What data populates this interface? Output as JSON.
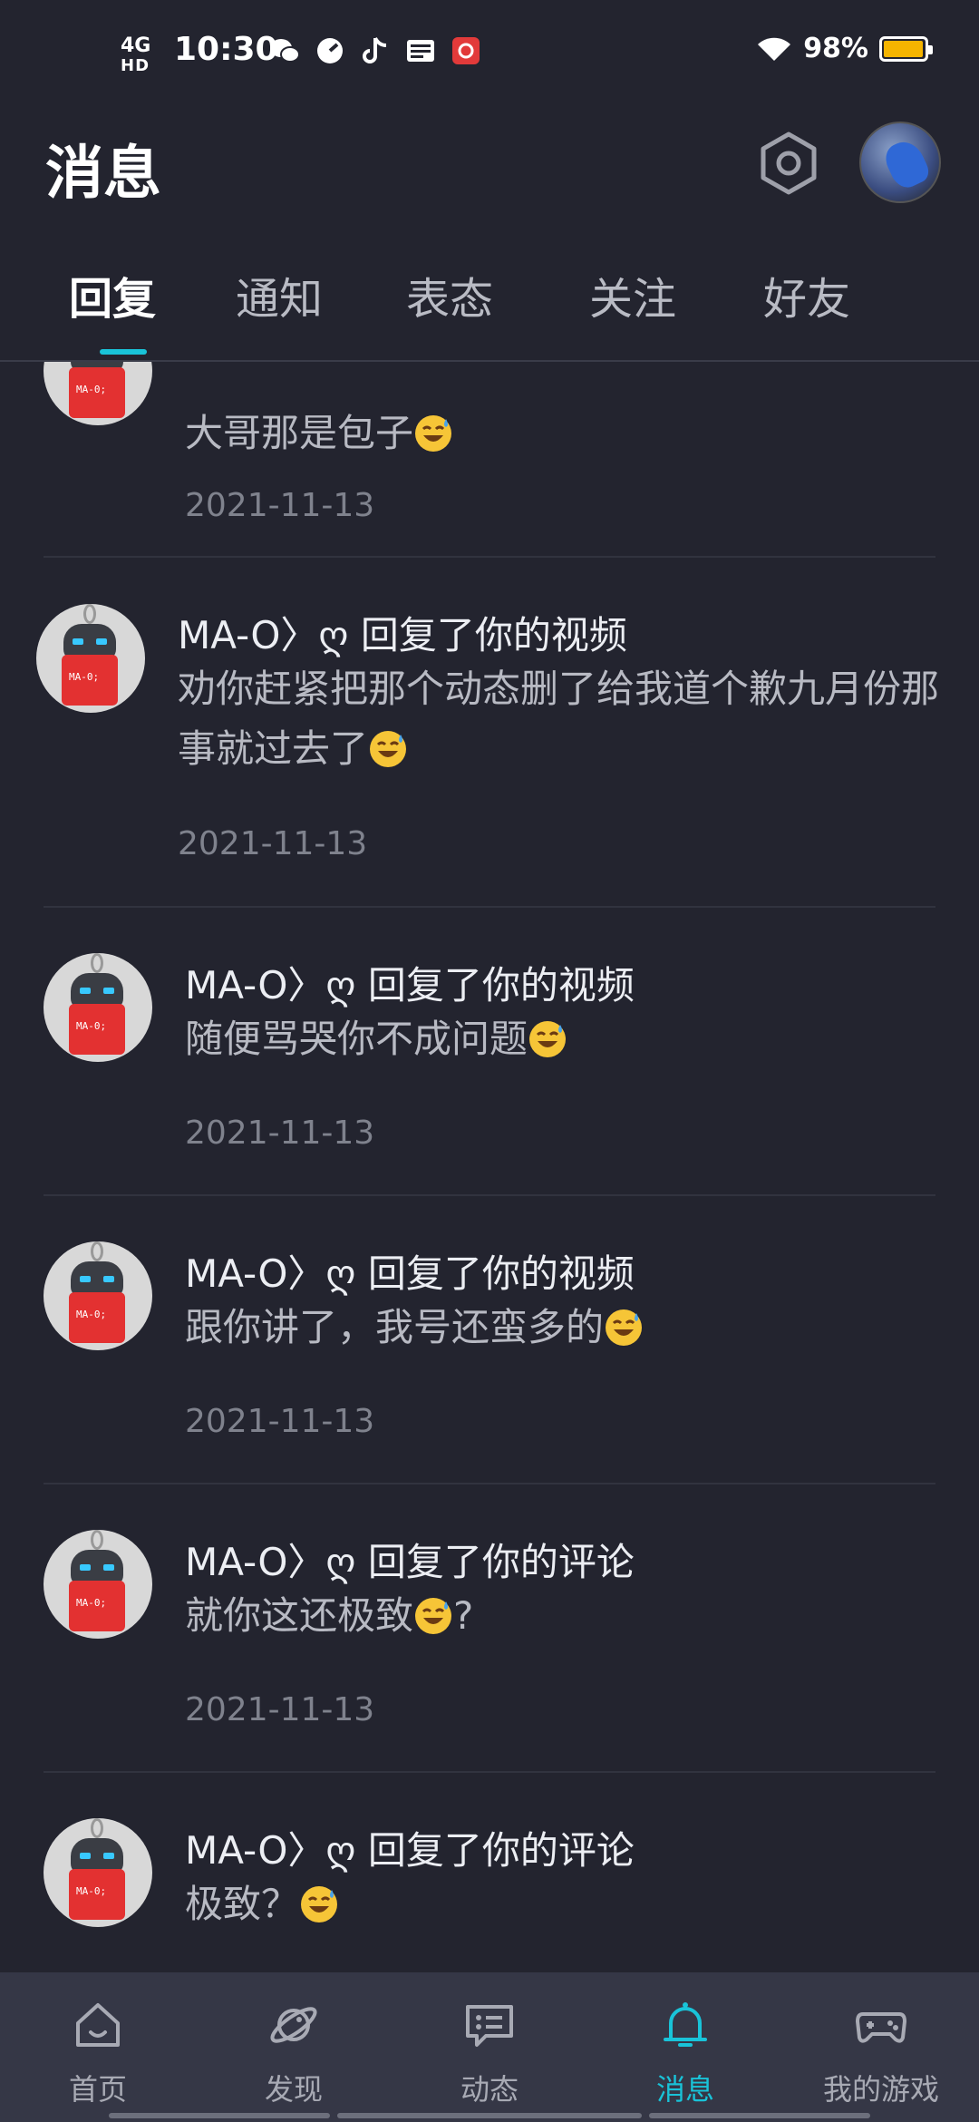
{
  "status_bar": {
    "network": "4G",
    "network_sub": "HD",
    "time": "10:30",
    "battery_text": "98%",
    "battery_level": 0.98,
    "battery_color": "#f5b400",
    "app_icons": [
      "wechat-icon",
      "speed-icon",
      "tiktok-icon",
      "toutiao-icon",
      "app-gift-icon"
    ]
  },
  "header": {
    "title": "消息",
    "settings_icon": "hexagon-settings-icon",
    "avatar_icon": "user-avatar"
  },
  "tabs": [
    {
      "label": "回复",
      "active": true
    },
    {
      "label": "通知",
      "active": false
    },
    {
      "label": "表态",
      "active": false
    },
    {
      "label": "关注",
      "active": false
    },
    {
      "label": "好友",
      "active": false
    }
  ],
  "accent_color": "#19c3d8",
  "messages": [
    {
      "user": "",
      "action": "",
      "text": "大哥那是包子",
      "emoji": "sweat-smile",
      "date": "2021-11-13"
    },
    {
      "user": "MA-O〉ღ",
      "action": "回复了你的视频",
      "text": "劝你赶紧把那个动态删了给我道个歉九月份那事就过去了",
      "emoji": "sweat-smile",
      "date": "2021-11-13"
    },
    {
      "user": "MA-O〉ღ",
      "action": "回复了你的视频",
      "text": "随便骂哭你不成问题",
      "emoji": "sweat-smile",
      "date": "2021-11-13"
    },
    {
      "user": "MA-O〉ღ",
      "action": "回复了你的视频",
      "text": "跟你讲了，我号还蛮多的",
      "emoji": "sweat-smile",
      "date": "2021-11-13"
    },
    {
      "user": "MA-O〉ღ",
      "action": "回复了你的评论",
      "text": "就你这还极致",
      "emoji": "sweat-smile",
      "suffix": "?",
      "date": "2021-11-13"
    },
    {
      "user": "MA-O〉ღ",
      "action": "回复了你的评论",
      "text": "极致？",
      "emoji": "sweat-smile",
      "date": ""
    }
  ],
  "bottom_nav": [
    {
      "label": "首页",
      "icon": "home-icon",
      "active": false
    },
    {
      "label": "发现",
      "icon": "planet-icon",
      "active": false
    },
    {
      "label": "动态",
      "icon": "chat-icon",
      "active": false
    },
    {
      "label": "消息",
      "icon": "bell-icon",
      "active": true
    },
    {
      "label": "我的游戏",
      "icon": "gamepad-icon",
      "active": false
    }
  ]
}
